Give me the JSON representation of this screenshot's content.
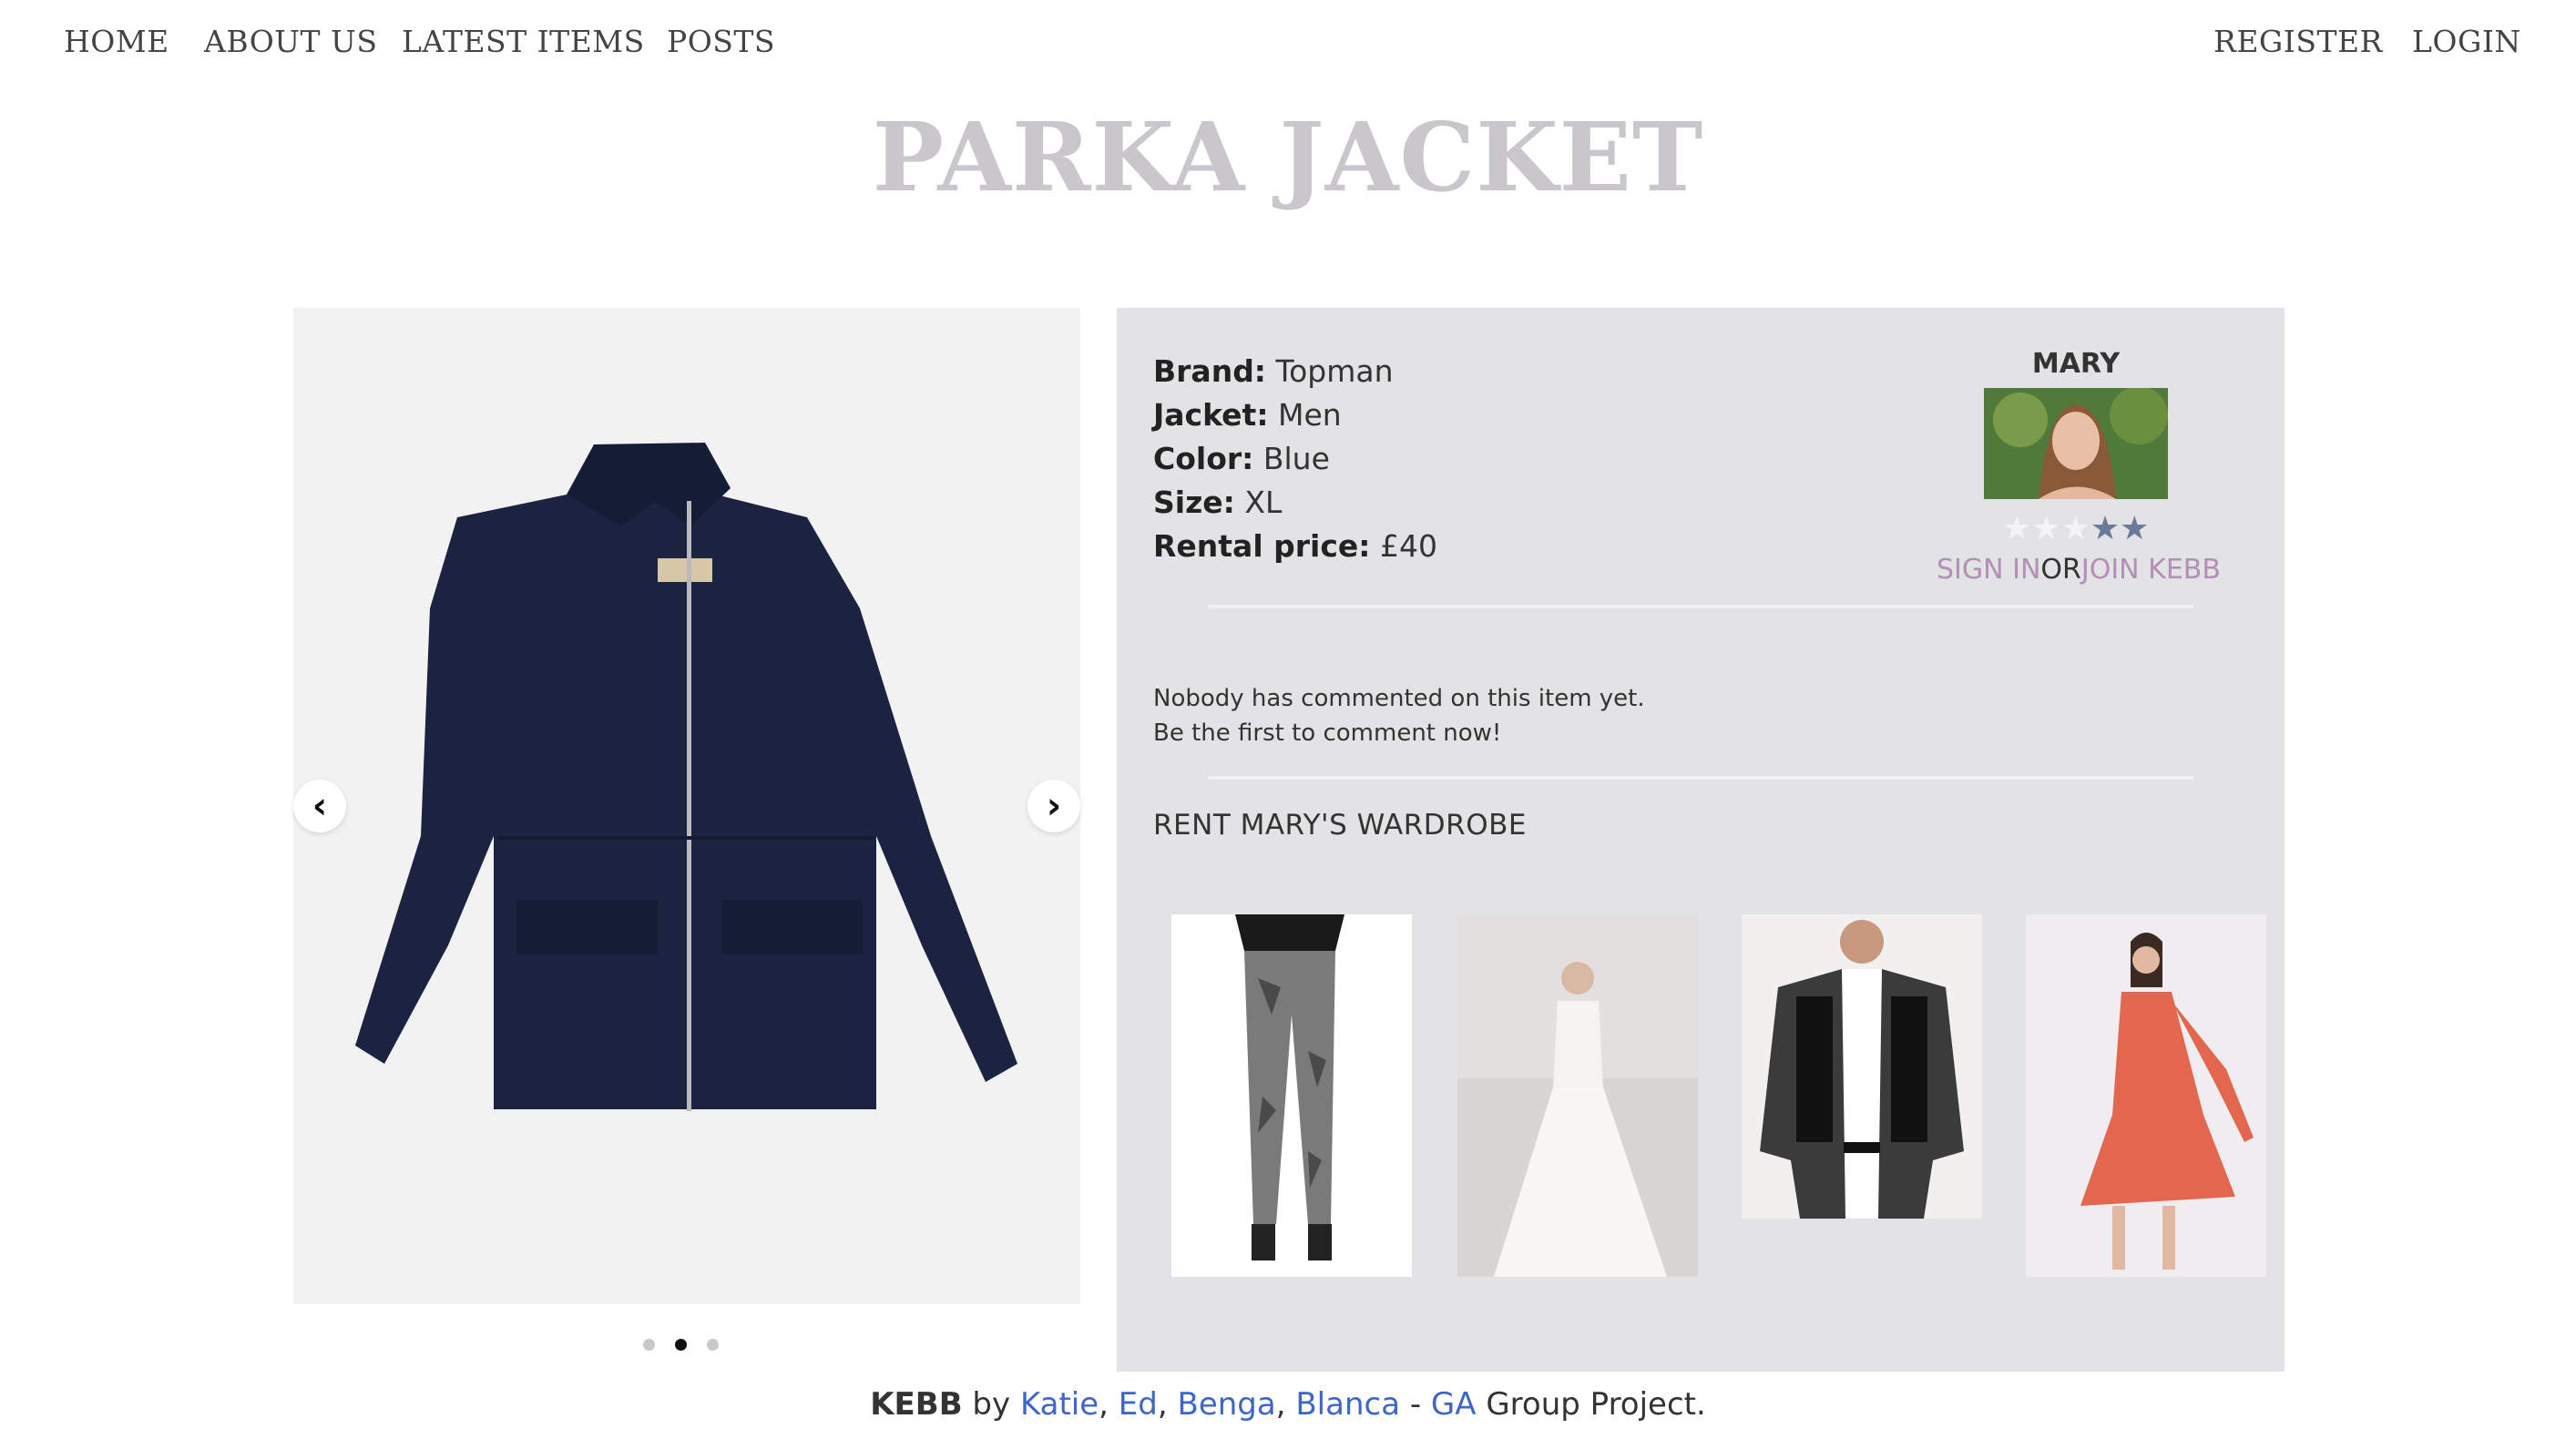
{
  "nav": {
    "home": "HOME",
    "about": "ABOUT US",
    "latest": "LATEST ITEMS",
    "posts": "POSTS",
    "register": "REGISTER",
    "login": "LOGIN"
  },
  "page_title": "PARKA JACKET",
  "carousel": {
    "active_index": 1,
    "total": 3
  },
  "item": {
    "brand_label": "Brand:",
    "brand": "Topman",
    "jacket_label": "Jacket:",
    "jacket": "Men",
    "color_label": "Color:",
    "color": "Blue",
    "size_label": "Size:",
    "size": "XL",
    "price_label": "Rental price:",
    "price": "£40"
  },
  "owner": {
    "name": "MARY",
    "rating": 2,
    "rating_max": 5,
    "sign_in": "SIGN IN",
    "or": "OR",
    "join": "JOIN KEBB"
  },
  "comments": {
    "line1": "Nobody has commented on this item yet.",
    "line2": "Be the first to comment now!"
  },
  "wardrobe": {
    "title": "RENT MARY'S WARDROBE",
    "items": [
      "camo-jeans",
      "wedding-dress",
      "blazer",
      "floral-dress"
    ]
  },
  "footer": {
    "brand": "KEBB",
    "by": " by ",
    "authors": [
      "Katie",
      "Ed",
      "Benga",
      "Blanca"
    ],
    "dash": " - ",
    "org": "GA",
    "suffix": " Group Project."
  },
  "colors": {
    "title": "#c9c6cc",
    "panel": "#e3e2e4",
    "link_purple": "#b28fb4",
    "link_blue": "#3e66c9",
    "star_on": "#6a7a9a"
  }
}
